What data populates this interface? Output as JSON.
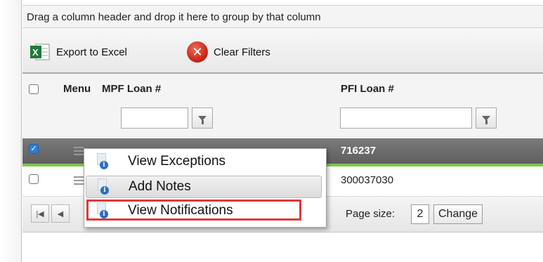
{
  "grid": {
    "group_panel_text": "Drag a column header and drop it here to group by that column",
    "toolbar": {
      "export_label": "Export to Excel",
      "clear_label": "Clear Filters"
    },
    "columns": {
      "menu": "Menu",
      "mpf_loan": "MPF Loan #",
      "pfi_loan": "PFI Loan #"
    },
    "rows": [
      {
        "selected": true,
        "pfi_loan": "716237"
      },
      {
        "selected": false,
        "pfi_loan": "300037030"
      }
    ],
    "pager": {
      "page_size_label": "Page size:",
      "page_size_value": "2",
      "change_label": "Change"
    }
  },
  "context_menu": {
    "items": [
      {
        "label": "View Exceptions",
        "icon": "info-document-icon"
      },
      {
        "label": "Add Notes",
        "icon": "info-document-icon"
      },
      {
        "label": "View Notifications",
        "icon": "info-document-icon"
      }
    ]
  },
  "colors": {
    "selected_row": "#6b6b6b",
    "selected_accent": "#7ec94a",
    "highlight": "#e0393a",
    "clear_icon": "#c51e12",
    "excel_green": "#1e7a3a"
  }
}
